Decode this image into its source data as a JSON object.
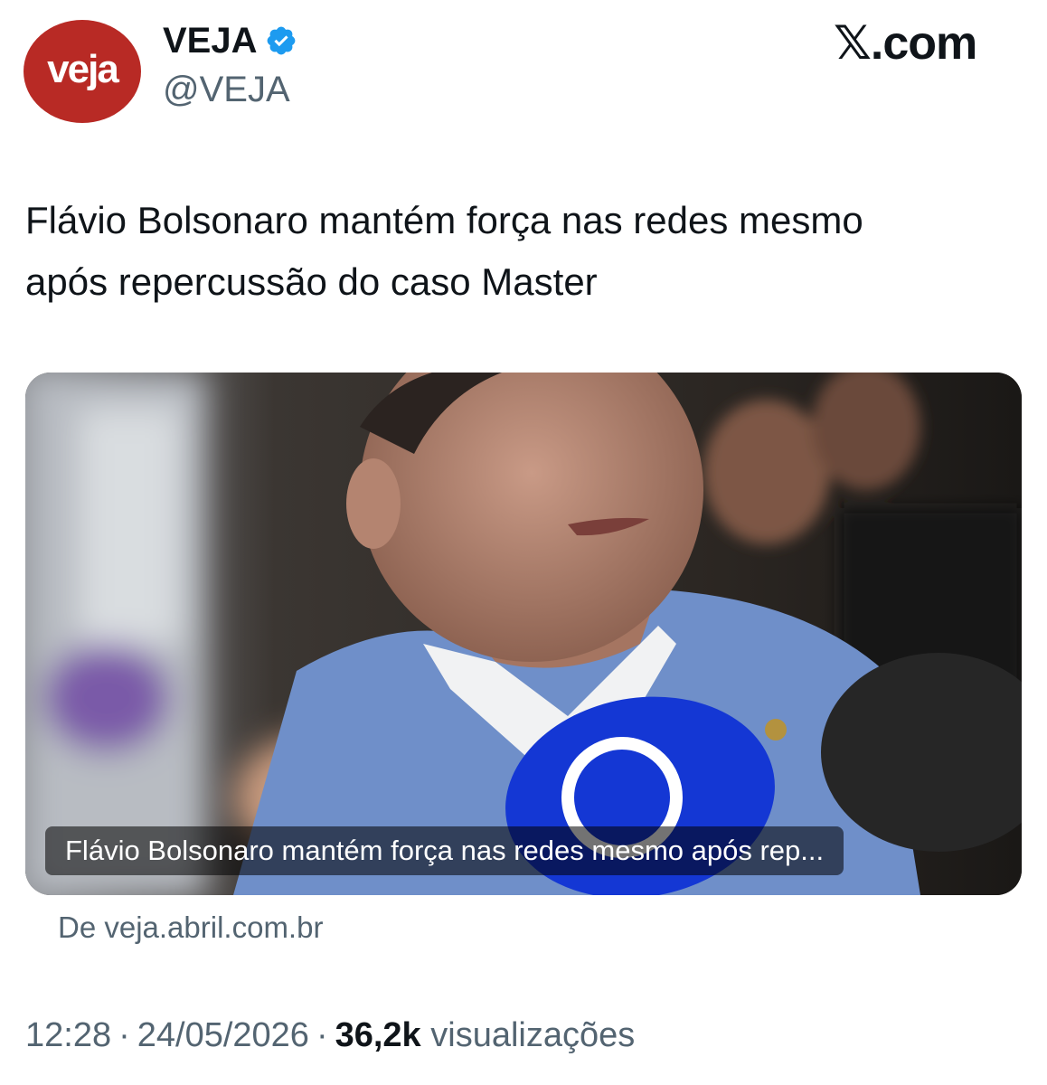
{
  "author": {
    "avatar_text": "veja",
    "avatar_color": "#b82a25",
    "name": "VEJA",
    "verified_icon": "verified-badge-icon",
    "handle": "@VEJA"
  },
  "site_mark": "𝕏.com",
  "tweet": {
    "text_line_1": "Flávio Bolsonaro mantém força nas redes mesmo",
    "text_line_2": "após repercussão do caso Master"
  },
  "card": {
    "caption": "Flávio Bolsonaro mantém força nas redes mesmo após rep...",
    "source": "De veja.abril.com.br"
  },
  "meta": {
    "time": "12:28",
    "date": "24/05/2026",
    "views_count": "36,2k",
    "views_label": "visualizações"
  },
  "colors": {
    "verified": "#1d9bf0",
    "secondary_text": "#536471",
    "primary_text": "#0f1419"
  }
}
